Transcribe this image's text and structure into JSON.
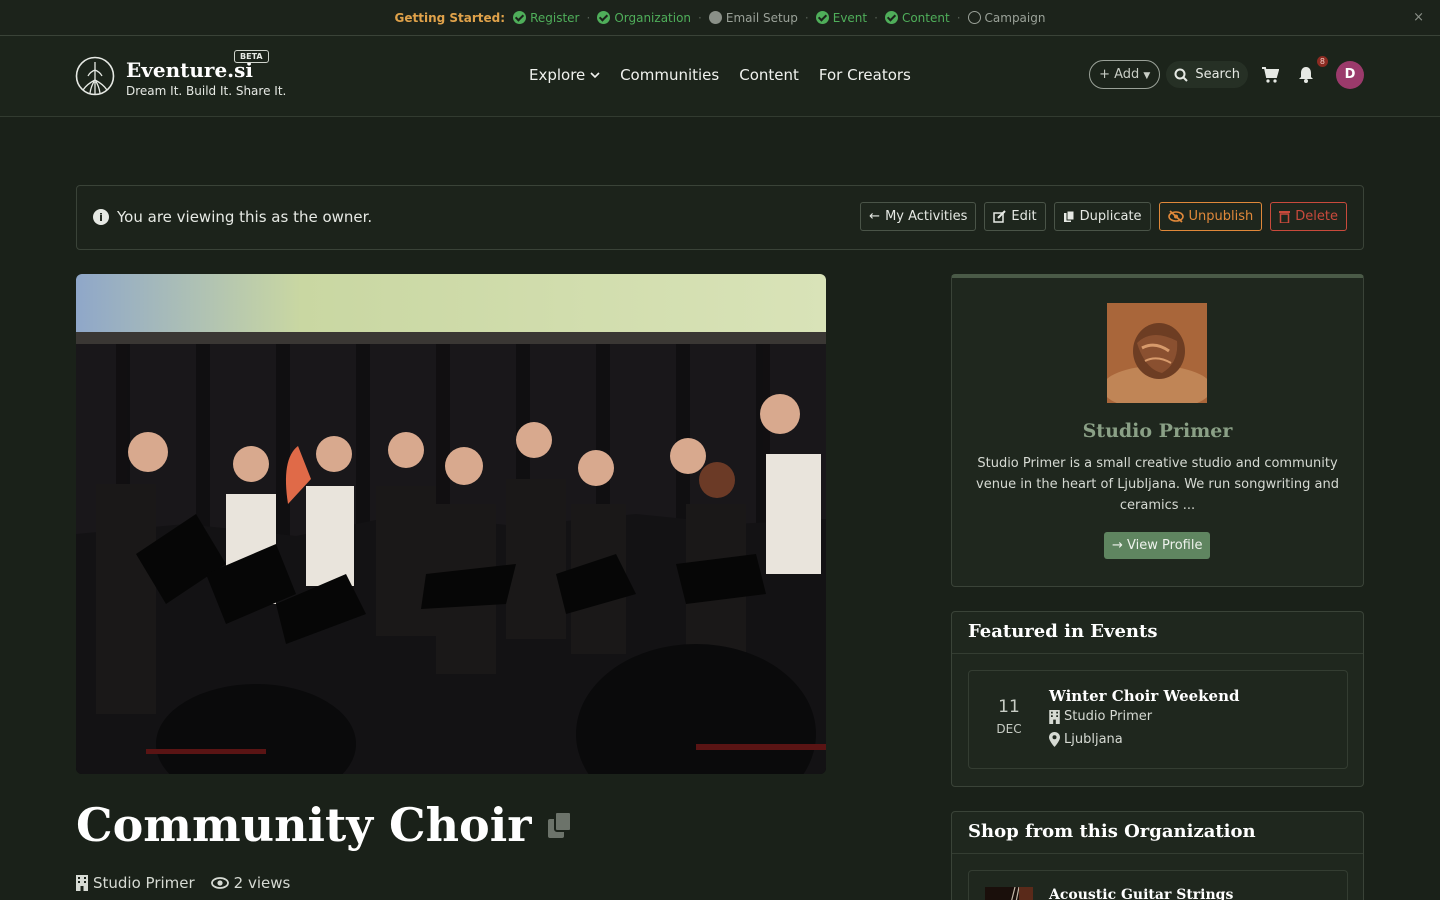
{
  "getting_started": {
    "label": "Getting Started:",
    "steps": [
      {
        "label": "Register",
        "state": "done"
      },
      {
        "label": "Organization",
        "state": "done"
      },
      {
        "label": "Email Setup",
        "state": "partial"
      },
      {
        "label": "Event",
        "state": "done"
      },
      {
        "label": "Content",
        "state": "done"
      },
      {
        "label": "Campaign",
        "state": "todo"
      }
    ],
    "close": "×"
  },
  "navbar": {
    "brand": "Eventure.si",
    "beta": "BETA",
    "tagline": "Dream It. Build It. Share It.",
    "links": [
      "Explore",
      "Communities",
      "Content",
      "For Creators"
    ],
    "add_label": "+ Add",
    "search_label": "Search",
    "notif_count": "8",
    "avatar_initial": "D"
  },
  "owner_bar": {
    "message": "You are viewing this as the owner.",
    "my_activities": "My Activities",
    "edit": "Edit",
    "duplicate": "Duplicate",
    "unpublish": "Unpublish",
    "delete": "Delete"
  },
  "content": {
    "title": "Community Choir",
    "organization": "Studio Primer",
    "views": "2 views"
  },
  "org_card": {
    "name": "Studio Primer",
    "description": "Studio Primer is a small creative studio and community venue in the heart of Ljubljana. We run songwriting and ceramics ...",
    "view_profile": "View Profile"
  },
  "featured_events": {
    "heading": "Featured in Events",
    "events": [
      {
        "day": "11",
        "month": "DEC",
        "title": "Winter Choir Weekend",
        "org": "Studio Primer",
        "location": "Ljubljana"
      }
    ]
  },
  "shop": {
    "heading": "Shop from this Organization",
    "products": [
      {
        "title": "Acoustic Guitar Strings"
      }
    ]
  },
  "colors": {
    "background": "#1a2119",
    "success": "#4fae5a",
    "warning": "#e0883a",
    "danger": "#c94a3c",
    "accent": "#5f8560"
  }
}
